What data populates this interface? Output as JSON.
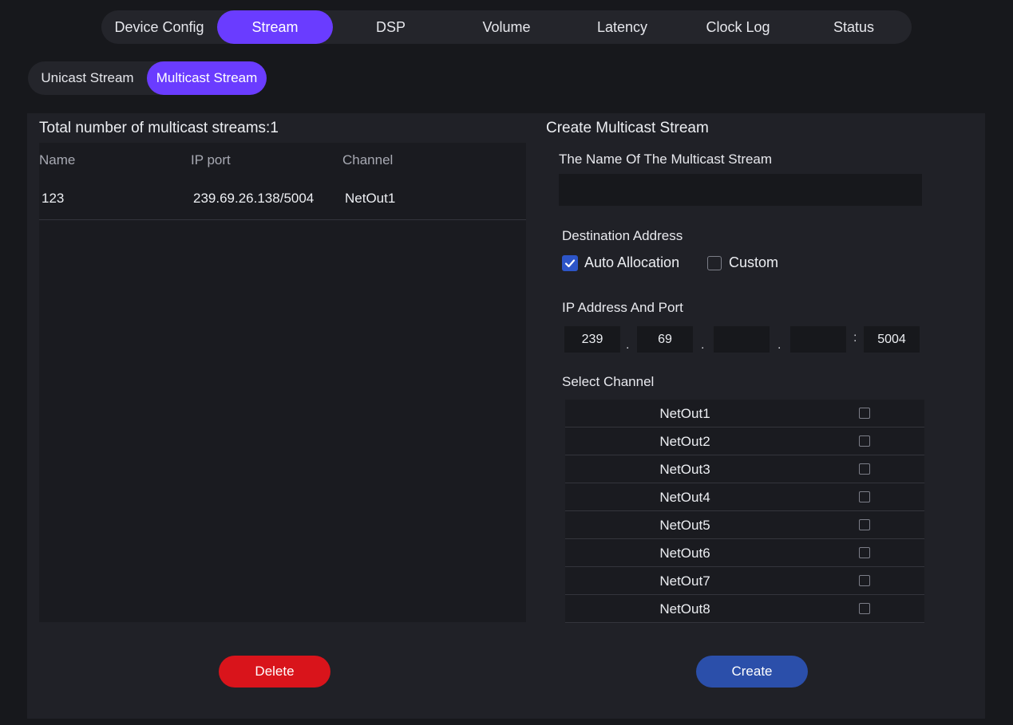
{
  "top_tabs": [
    "Device Config",
    "Stream",
    "DSP",
    "Volume",
    "Latency",
    "Clock Log",
    "Status"
  ],
  "active_top_tab": "Stream",
  "sub_tabs": [
    "Unicast Stream",
    "Multicast Stream"
  ],
  "active_sub_tab": "Multicast Stream",
  "left": {
    "total_label": "Total number of multicast streams:1",
    "headers": {
      "name": "Name",
      "ip_port": "IP port",
      "channel": "Channel"
    },
    "rows": [
      {
        "name": "123",
        "ip_port": "239.69.26.138/5004",
        "channel": "NetOut1"
      }
    ],
    "delete_label": "Delete"
  },
  "right": {
    "title": "Create Multicast Stream",
    "name_label": "The Name Of The Multicast Stream",
    "name_value": "",
    "dest_label": "Destination Address",
    "auto_label": "Auto Allocation",
    "auto_checked": true,
    "custom_label": "Custom",
    "custom_checked": false,
    "ip_label": "IP Address And Port",
    "ip": {
      "o1": "239",
      "o2": "69",
      "o3": "",
      "o4": "",
      "port": "5004"
    },
    "ip_sep_dot": ".",
    "ip_sep_colon": ":",
    "channel_label": "Select Channel",
    "channels": [
      "NetOut1",
      "NetOut2",
      "NetOut3",
      "NetOut4",
      "NetOut5",
      "NetOut6",
      "NetOut7",
      "NetOut8"
    ],
    "create_label": "Create"
  },
  "colors": {
    "accent": "#6a3cff",
    "delete": "#d9141b",
    "create": "#2b4faa",
    "checkbox_checked": "#2d55c8"
  },
  "icons": {
    "checkmark": "check-icon"
  }
}
